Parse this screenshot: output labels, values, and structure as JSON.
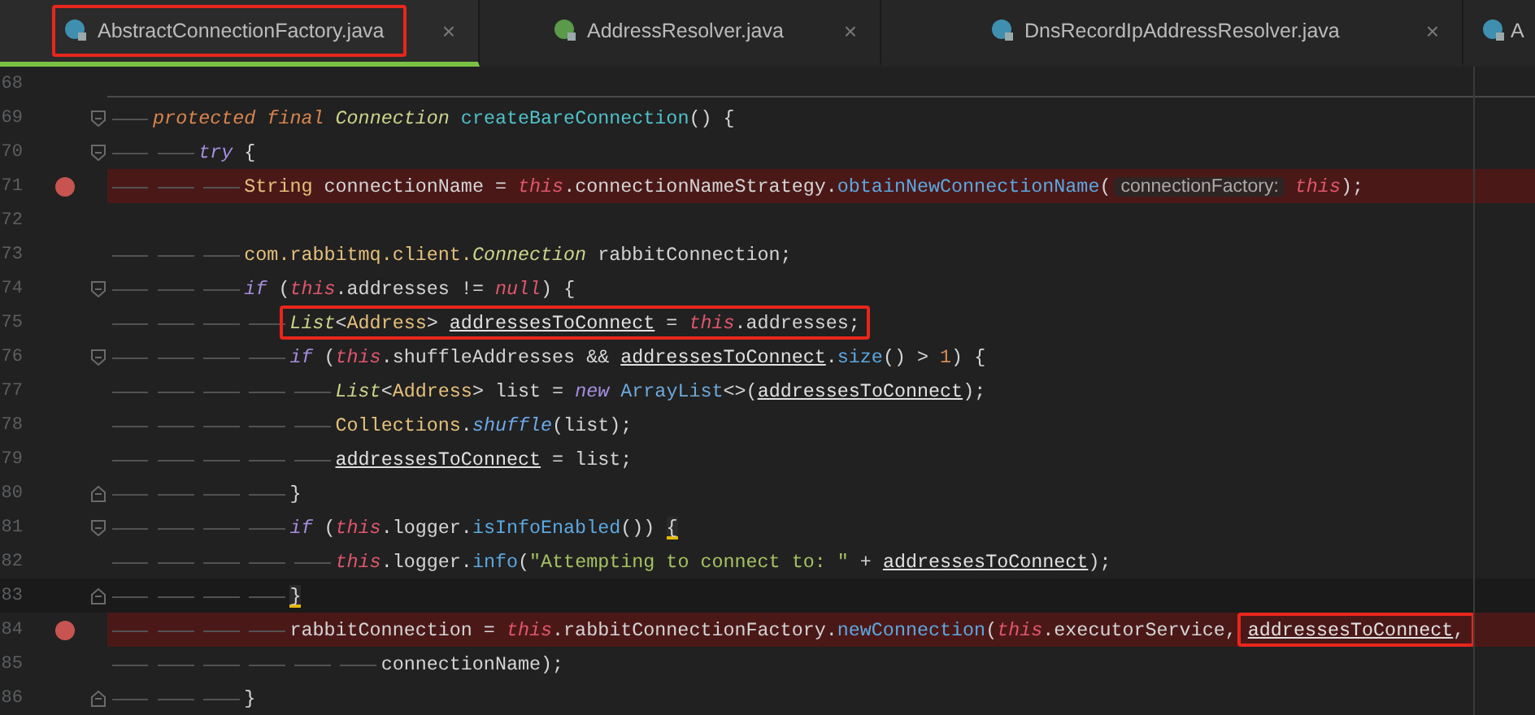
{
  "tabs": [
    {
      "label": "AbstractConnectionFactory.java",
      "kind": "class",
      "selected": true,
      "highlighted": true,
      "close": "×"
    },
    {
      "label": "AddressResolver.java",
      "kind": "interface",
      "selected": false,
      "highlighted": false,
      "close": "×"
    },
    {
      "label": "DnsRecordIpAddressResolver.java",
      "kind": "class",
      "selected": false,
      "highlighted": false,
      "close": "×"
    },
    {
      "label": "A",
      "kind": "class",
      "selected": false,
      "highlighted": false
    }
  ],
  "lines": [
    {
      "number": "68",
      "separator_below": true
    },
    {
      "number": "69",
      "fold_open": true,
      "tokens": [
        {
          "kind": "mod",
          "text": "protected final"
        },
        {
          "kind": "itype",
          "text": " Connection"
        },
        {
          "kind": "fndecl",
          "text": " createBareConnection"
        },
        {
          "kind": "plain",
          "text": "() {"
        }
      ],
      "children": [
        {
          "number": "70",
          "fold_open": true,
          "tokens": [
            {
              "kind": "kw",
              "text": "try"
            },
            {
              "kind": "plain",
              "text": " {"
            }
          ],
          "children": [
            {
              "number": "71",
              "breakpoint": true,
              "tokens": [
                {
                  "kind": "type",
                  "text": "String"
                },
                {
                  "kind": "plain",
                  "text": " connectionName = "
                },
                {
                  "kind": "self",
                  "text": "this"
                },
                {
                  "kind": "plain",
                  "text": ".connectionNameStrategy."
                },
                {
                  "kind": "fn",
                  "text": "obtainNewConnectionName"
                },
                {
                  "kind": "plain",
                  "text": "("
                },
                {
                  "kind": "hint",
                  "text": "connectionFactory:"
                },
                {
                  "kind": "self",
                  "text": "this"
                },
                {
                  "kind": "plain",
                  "text": ");"
                }
              ]
            },
            {
              "number": "72"
            },
            {
              "number": "73",
              "tokens": [
                {
                  "kind": "type",
                  "text": "com.rabbitmq.client."
                },
                {
                  "kind": "itype",
                  "text": "Connection"
                },
                {
                  "kind": "plain",
                  "text": " rabbitConnection;"
                }
              ]
            },
            {
              "number": "74",
              "fold_open": true,
              "tokens": [
                {
                  "kind": "kw",
                  "text": "if"
                },
                {
                  "kind": "plain",
                  "text": " ("
                },
                {
                  "kind": "self",
                  "text": "this"
                },
                {
                  "kind": "plain",
                  "text": ".addresses != "
                },
                {
                  "kind": "self",
                  "text": "null"
                },
                {
                  "kind": "plain",
                  "text": ") {"
                }
              ],
              "children": [
                {
                  "number": "75",
                  "tokens": [
                    {
                      "kind": "frame",
                      "tokens": [
                        {
                          "kind": "itype",
                          "text": "List"
                        },
                        {
                          "kind": "plain",
                          "text": "<"
                        },
                        {
                          "kind": "type",
                          "text": "Address"
                        },
                        {
                          "kind": "plain",
                          "text": "> "
                        },
                        {
                          "kind": "var",
                          "text": "addressesToConnect"
                        },
                        {
                          "kind": "plain",
                          "text": " = "
                        },
                        {
                          "kind": "self",
                          "text": "this"
                        },
                        {
                          "kind": "plain",
                          "text": ".addresses;"
                        }
                      ]
                    }
                  ]
                },
                {
                  "number": "76",
                  "fold_open": true,
                  "tokens": [
                    {
                      "kind": "kw",
                      "text": "if"
                    },
                    {
                      "kind": "plain",
                      "text": " ("
                    },
                    {
                      "kind": "self",
                      "text": "this"
                    },
                    {
                      "kind": "plain",
                      "text": ".shuffleAddresses && "
                    },
                    {
                      "kind": "var",
                      "text": "addressesToConnect"
                    },
                    {
                      "kind": "plain",
                      "text": "."
                    },
                    {
                      "kind": "fn",
                      "text": "size"
                    },
                    {
                      "kind": "plain",
                      "text": "() > "
                    },
                    {
                      "kind": "num",
                      "text": "1"
                    },
                    {
                      "kind": "plain",
                      "text": ") {"
                    }
                  ],
                  "children": [
                    {
                      "number": "77",
                      "tokens": [
                        {
                          "kind": "itype",
                          "text": "List"
                        },
                        {
                          "kind": "plain",
                          "text": "<"
                        },
                        {
                          "kind": "type",
                          "text": "Address"
                        },
                        {
                          "kind": "plain",
                          "text": "> list = "
                        },
                        {
                          "kind": "kw",
                          "text": "new"
                        },
                        {
                          "kind": "cls",
                          "text": " ArrayList"
                        },
                        {
                          "kind": "plain",
                          "text": "<>("
                        },
                        {
                          "kind": "var",
                          "text": "addressesToConnect"
                        },
                        {
                          "kind": "plain",
                          "text": ");"
                        }
                      ]
                    },
                    {
                      "number": "78",
                      "tokens": [
                        {
                          "kind": "type",
                          "text": "Collections"
                        },
                        {
                          "kind": "plain",
                          "text": "."
                        },
                        {
                          "kind": "sfn",
                          "text": "shuffle"
                        },
                        {
                          "kind": "plain",
                          "text": "(list);"
                        }
                      ]
                    },
                    {
                      "number": "79",
                      "tokens": [
                        {
                          "kind": "var",
                          "text": "addressesToConnect"
                        },
                        {
                          "kind": "plain",
                          "text": " = list;"
                        }
                      ]
                    }
                  ]
                },
                {
                  "number": "80",
                  "fold_close": true,
                  "tokens": [
                    {
                      "kind": "plain",
                      "text": "}"
                    }
                  ]
                },
                {
                  "number": "81",
                  "fold_open": true,
                  "tokens": [
                    {
                      "kind": "kw",
                      "text": "if"
                    },
                    {
                      "kind": "plain",
                      "text": " ("
                    },
                    {
                      "kind": "self",
                      "text": "this"
                    },
                    {
                      "kind": "plain",
                      "text": ".logger."
                    },
                    {
                      "kind": "fn",
                      "text": "isInfoEnabled"
                    },
                    {
                      "kind": "plain",
                      "text": "()) "
                    },
                    {
                      "kind": "brace",
                      "text": "{"
                    }
                  ],
                  "children": [
                    {
                      "number": "82",
                      "tokens": [
                        {
                          "kind": "self",
                          "text": "this"
                        },
                        {
                          "kind": "plain",
                          "text": ".logger."
                        },
                        {
                          "kind": "fn",
                          "text": "info"
                        },
                        {
                          "kind": "plain",
                          "text": "("
                        },
                        {
                          "kind": "str",
                          "text": "\"Attempting to connect to: \""
                        },
                        {
                          "kind": "plain",
                          "text": " + "
                        },
                        {
                          "kind": "var",
                          "text": "addressesToConnect"
                        },
                        {
                          "kind": "plain",
                          "text": ");"
                        }
                      ]
                    }
                  ]
                },
                {
                  "number": "83",
                  "fold_close": true,
                  "current": true,
                  "tokens": [
                    {
                      "kind": "brace",
                      "text": "}"
                    }
                  ]
                },
                {
                  "number": "84",
                  "breakpoint": true,
                  "tokens": [
                    {
                      "kind": "plain",
                      "text": "rabbitConnection = "
                    },
                    {
                      "kind": "self",
                      "text": "this"
                    },
                    {
                      "kind": "plain",
                      "text": ".rabbitConnectionFactory."
                    },
                    {
                      "kind": "fn",
                      "text": "newConnection"
                    },
                    {
                      "kind": "plain",
                      "text": "("
                    },
                    {
                      "kind": "self",
                      "text": "this"
                    },
                    {
                      "kind": "plain",
                      "text": ".executorService, "
                    },
                    {
                      "kind": "frame",
                      "tokens": [
                        {
                          "kind": "var",
                          "text": "addressesToConnect"
                        },
                        {
                          "kind": "plain",
                          "text": ","
                        }
                      ]
                    }
                  ],
                  "children": [
                    {
                      "number": "85",
                      "kind": "continuation",
                      "tokens": [
                        {
                          "kind": "plain",
                          "text": "connectionName);"
                        }
                      ]
                    }
                  ]
                }
              ]
            },
            {
              "number": "86",
              "fold_close": true,
              "tokens": [
                {
                  "kind": "plain",
                  "text": "}"
                }
              ]
            }
          ]
        }
      ]
    }
  ]
}
